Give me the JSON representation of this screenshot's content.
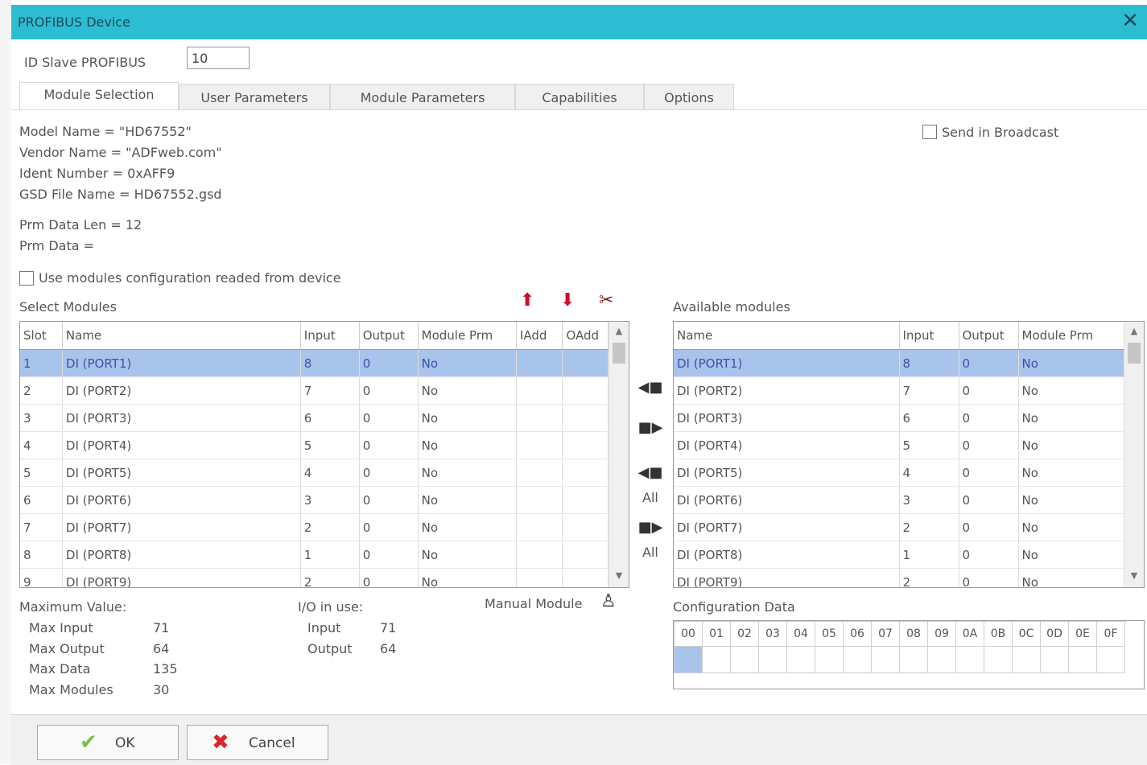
{
  "window": {
    "title": "PROFIBUS Device",
    "close_label": "✕"
  },
  "id_slave": {
    "label": "ID Slave PROFIBUS",
    "value": "10"
  },
  "tabs": [
    {
      "label": "Module Selection"
    },
    {
      "label": "User Parameters"
    },
    {
      "label": "Module Parameters"
    },
    {
      "label": "Capabilities"
    },
    {
      "label": "Options"
    }
  ],
  "info": {
    "model_name": "Model Name = \"HD67552\"",
    "vendor_name": "Vendor Name = \"ADFweb.com\"",
    "ident_number": "Ident Number = 0xAFF9",
    "gsd_file": "GSD File Name = HD67552.gsd",
    "prm_data_len": "Prm Data Len = 12",
    "prm_data": "Prm Data ="
  },
  "send_broadcast": {
    "label": "Send in Broadcast",
    "checked": false
  },
  "use_modules_config": {
    "label": "Use modules configuration readed from device",
    "checked": false
  },
  "select_modules": {
    "title": "Select Modules",
    "columns": [
      "Slot",
      "Name",
      "Input",
      "Output",
      "Module Prm",
      "IAdd",
      "OAdd"
    ],
    "rows": [
      [
        "1",
        "DI (PORT1)",
        "8",
        "0",
        "No",
        "",
        ""
      ],
      [
        "2",
        "DI (PORT2)",
        "7",
        "0",
        "No",
        "",
        ""
      ],
      [
        "3",
        "DI (PORT3)",
        "6",
        "0",
        "No",
        "",
        ""
      ],
      [
        "4",
        "DI (PORT4)",
        "5",
        "0",
        "No",
        "",
        ""
      ],
      [
        "5",
        "DI (PORT5)",
        "4",
        "0",
        "No",
        "",
        ""
      ],
      [
        "6",
        "DI (PORT6)",
        "3",
        "0",
        "No",
        "",
        ""
      ],
      [
        "7",
        "DI (PORT7)",
        "2",
        "0",
        "No",
        "",
        ""
      ],
      [
        "8",
        "DI (PORT8)",
        "1",
        "0",
        "No",
        "",
        ""
      ],
      [
        "9",
        "DI (PORT9)",
        "2",
        "0",
        "No",
        "",
        ""
      ]
    ]
  },
  "available_modules": {
    "title": "Available modules",
    "columns": [
      "Name",
      "Input",
      "Output",
      "Module Prm"
    ],
    "rows": [
      [
        "DI (PORT1)",
        "8",
        "0",
        "No"
      ],
      [
        "DI (PORT2)",
        "7",
        "0",
        "No"
      ],
      [
        "DI (PORT3)",
        "6",
        "0",
        "No"
      ],
      [
        "DI (PORT4)",
        "5",
        "0",
        "No"
      ],
      [
        "DI (PORT5)",
        "4",
        "0",
        "No"
      ],
      [
        "DI (PORT6)",
        "3",
        "0",
        "No"
      ],
      [
        "DI (PORT7)",
        "2",
        "0",
        "No"
      ],
      [
        "DI (PORT8)",
        "1",
        "0",
        "No"
      ],
      [
        "DI (PORT9)",
        "2",
        "0",
        "No"
      ]
    ]
  },
  "transfer": {
    "all_label_1": "All",
    "all_label_2": "All"
  },
  "maximum_values": {
    "title": "Maximum Value:",
    "items": [
      {
        "label": "Max Input",
        "value": "71"
      },
      {
        "label": "Max Output",
        "value": "64"
      },
      {
        "label": "Max Data",
        "value": "135"
      },
      {
        "label": "Max Modules",
        "value": "30"
      }
    ]
  },
  "io_in_use": {
    "title": "I/O in use:",
    "items": [
      {
        "label": "Input",
        "value": "71"
      },
      {
        "label": "Output",
        "value": "64"
      }
    ]
  },
  "manual_module": {
    "label": "Manual Module"
  },
  "configuration_data": {
    "title": "Configuration Data",
    "headers": [
      "00",
      "01",
      "02",
      "03",
      "04",
      "05",
      "06",
      "07",
      "08",
      "09",
      "0A",
      "0B",
      "0C",
      "0D",
      "0E",
      "0F"
    ]
  },
  "footer": {
    "ok_label": "OK",
    "cancel_label": "Cancel"
  },
  "colors": {
    "titlebar": "#2dbdd3",
    "selection": "#a9c4ea",
    "ok_check": "#7ac043",
    "cancel_x": "#d8262b",
    "arrow_red": "#c8102e"
  },
  "icons": [
    "close-icon",
    "arrow-up-icon",
    "arrow-down-icon",
    "delete-icon",
    "move-left-icon",
    "move-right-icon",
    "move-all-left-icon",
    "move-all-right-icon",
    "manual-module-icon",
    "ok-check-icon",
    "cancel-x-icon"
  ]
}
